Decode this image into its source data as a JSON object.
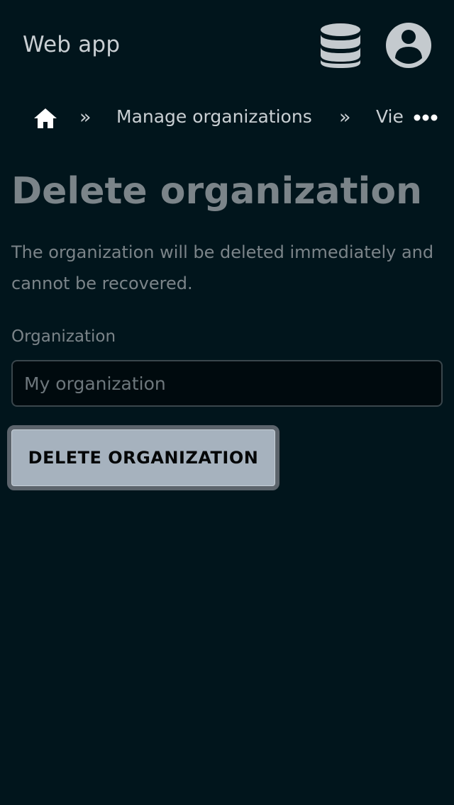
{
  "app": {
    "title": "Web app"
  },
  "header_icons": {
    "database": "database-icon",
    "account": "user-circle-icon"
  },
  "breadcrumb": {
    "home_icon": "home-icon",
    "separator": "»",
    "items": [
      {
        "label": "Manage organizations"
      },
      {
        "label": "Vie"
      }
    ],
    "more_icon": "ellipsis-icon"
  },
  "page": {
    "title": "Delete organization",
    "description": "The organization will be deleted immediately and cannot be recovered."
  },
  "form": {
    "organization_label": "Organization",
    "organization_placeholder": "My organization",
    "organization_value": ""
  },
  "actions": {
    "delete_label": "DELETE ORGANIZATION"
  },
  "colors": {
    "background": "#01151c",
    "text_primary": "#c9cfd3",
    "text_muted": "#7b8489",
    "button_bg": "#a6b2be",
    "button_border": "#5c646c"
  }
}
